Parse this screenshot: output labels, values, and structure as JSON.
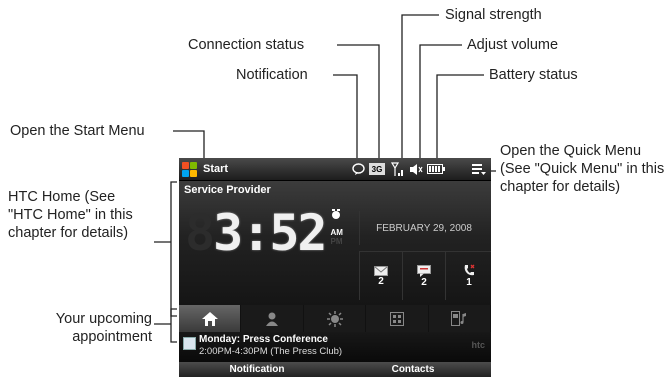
{
  "callouts": {
    "signal_strength": "Signal strength",
    "connection_status": "Connection status",
    "adjust_volume": "Adjust volume",
    "notification": "Notification",
    "battery_status": "Battery status",
    "open_start_menu": "Open the Start Menu",
    "open_quick_menu": "Open the Quick Menu (See \"Quick Menu\" in this chapter for details)",
    "htc_home": "HTC Home (See \"HTC Home\" in this chapter for details)",
    "upcoming_appointment": "Your upcoming appointment"
  },
  "screen": {
    "start_label": "Start",
    "provider": "Service Provider",
    "clock": {
      "digits": "3:52",
      "am": "AM",
      "pm": "PM"
    },
    "date": "FEBRUARY 29, 2008",
    "counters": {
      "messages": "2",
      "notes": "2",
      "calls": "1"
    },
    "network": "3G",
    "tabs": [
      "home-icon",
      "person-icon",
      "weather-icon",
      "settings-icon",
      "music-icon"
    ],
    "appointment": {
      "title": "Monday: Press Conference",
      "time": "2:00PM-4:30PM (The Press Club)"
    },
    "brand": "htc",
    "softkeys": {
      "left": "Notification",
      "right": "Contacts"
    }
  }
}
